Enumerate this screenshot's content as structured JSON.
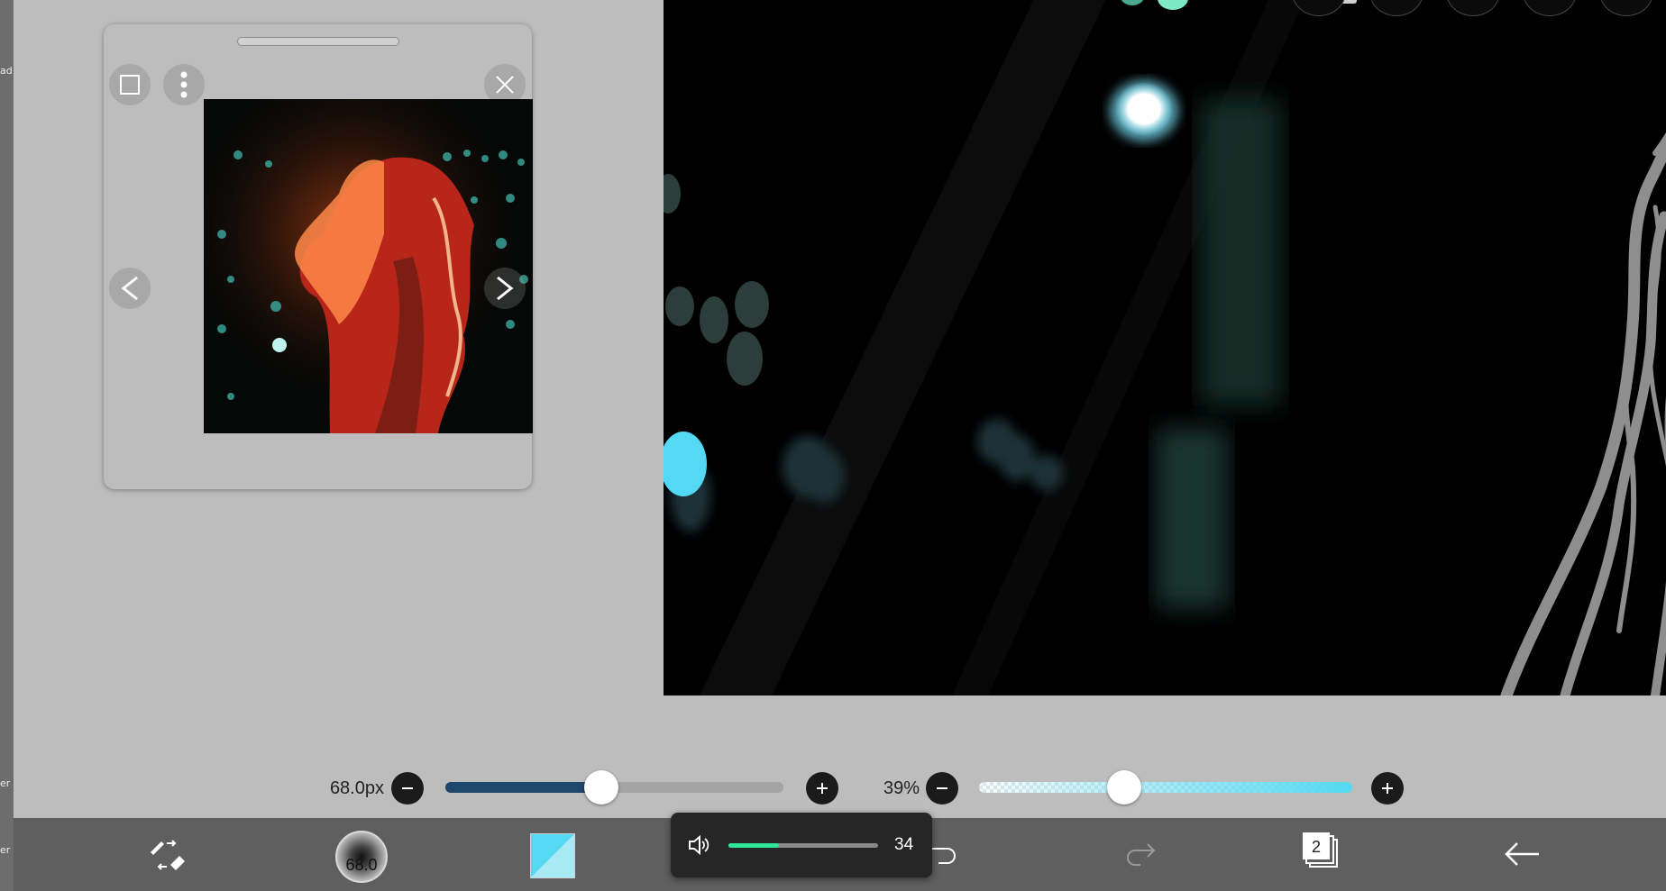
{
  "left_strip": {
    "frag_top": "ad",
    "frag_mid": "er",
    "frag_bottom": "er"
  },
  "reference_panel": {
    "icons": [
      "square-icon",
      "more-vertical-icon",
      "close-icon",
      "chevron-left-icon",
      "chevron-right-icon"
    ]
  },
  "brush": {
    "size_label": "68.0px",
    "size_fraction": 0.46,
    "preview_value": "68.0"
  },
  "opacity": {
    "label": "39%",
    "fraction": 0.39
  },
  "volume": {
    "value": "34",
    "fraction": 0.34
  },
  "toolbar": {
    "layer_count": "2"
  },
  "colors": {
    "accent": "#54d9f2",
    "size_track": "#21466b",
    "volume_fill": "#2ee59a",
    "toolbar_bg": "#5f5f5f"
  }
}
